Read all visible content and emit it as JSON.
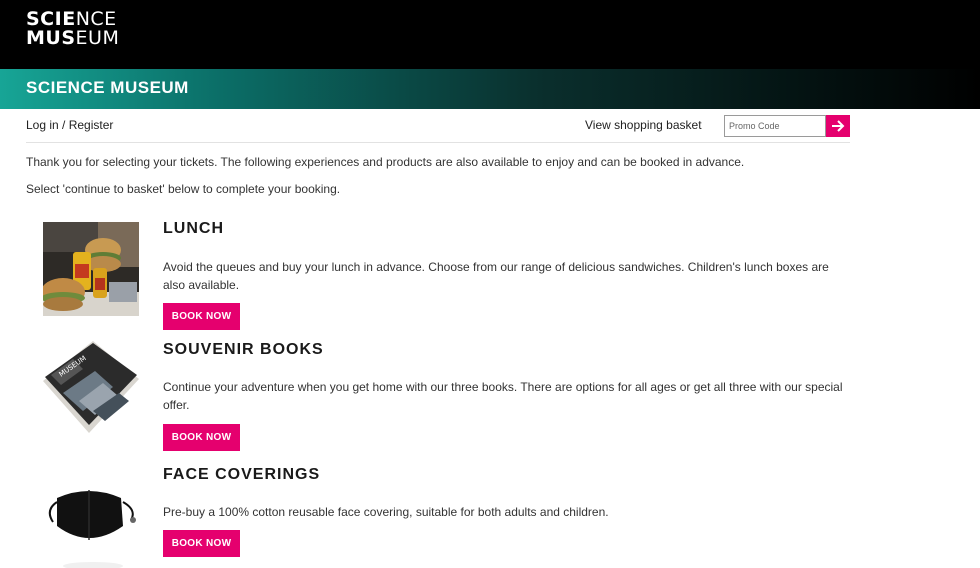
{
  "brand": {
    "logo_line1_bold": "SCIE",
    "logo_line1_thin": "NCE",
    "logo_line2_bold": "MUS",
    "logo_line2_thin": "EUM",
    "banner_title": "SCIENCE MUSEUM",
    "accent_color": "#e5006e",
    "teal_color": "#17a596"
  },
  "utility": {
    "login_label": "Log in / Register",
    "basket_label": "View shopping basket",
    "promo_placeholder": "Promo Code",
    "promo_submit_icon": "arrow-right-icon"
  },
  "intro": {
    "line1": "Thank you for selecting your tickets. The following experiences and products are also available to enjoy and can be booked in advance.",
    "line2": "Select 'continue to basket' below to complete your booking."
  },
  "products": [
    {
      "title": "LUNCH",
      "description": "Avoid the queues and buy your lunch in advance. Choose from our range of delicious sandwiches. Children's lunch boxes are also available.",
      "button": "BOOK NOW",
      "image": "lunch-photo"
    },
    {
      "title": "SOUVENIR BOOKS",
      "description": "Continue your adventure when you get home with our three books. There are options for all ages or get all three with our special offer.",
      "button": "BOOK NOW",
      "image": "souvenir-books-photo"
    },
    {
      "title": "FACE COVERINGS",
      "description": "Pre-buy a 100% cotton reusable face covering, suitable for both adults and children.",
      "button": "BOOK NOW",
      "image": "face-covering-photo"
    }
  ]
}
